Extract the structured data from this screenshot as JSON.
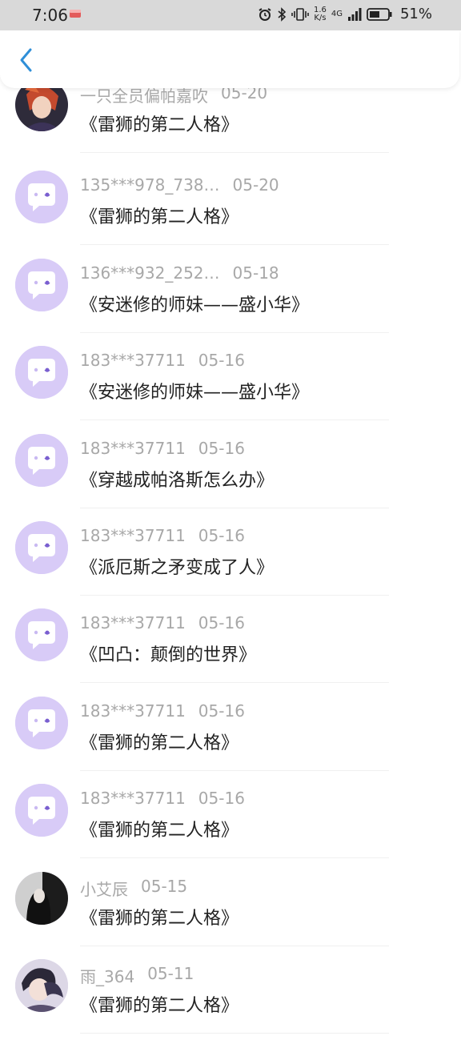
{
  "status": {
    "time": "7:06",
    "speed_value": "1.6",
    "speed_unit": "K/s",
    "network": "4G",
    "battery": "51%"
  },
  "comments": [
    {
      "user": "一只全员偏帕嘉吹",
      "date": "05-20",
      "title": "《雷狮的第二人格》",
      "avatar": "photo-anime-red"
    },
    {
      "user": "135***978_738…",
      "date": "05-20",
      "title": "《雷狮的第二人格》",
      "avatar": "default-purple"
    },
    {
      "user": "136***932_252…",
      "date": "05-18",
      "title": "《安迷修的师妹——盛小华》",
      "avatar": "default-purple"
    },
    {
      "user": "183***37711",
      "date": "05-16",
      "title": "《安迷修的师妹——盛小华》",
      "avatar": "default-purple"
    },
    {
      "user": "183***37711",
      "date": "05-16",
      "title": "《穿越成帕洛斯怎么办》",
      "avatar": "default-purple"
    },
    {
      "user": "183***37711",
      "date": "05-16",
      "title": "《派厄斯之矛变成了人》",
      "avatar": "default-purple"
    },
    {
      "user": "183***37711",
      "date": "05-16",
      "title": "《凹凸：颠倒的世界》",
      "avatar": "default-purple"
    },
    {
      "user": "183***37711",
      "date": "05-16",
      "title": "《雷狮的第二人格》",
      "avatar": "default-purple"
    },
    {
      "user": "183***37711",
      "date": "05-16",
      "title": "《雷狮的第二人格》",
      "avatar": "default-purple"
    },
    {
      "user": "小艾辰",
      "date": "05-15",
      "title": "《雷狮的第二人格》",
      "avatar": "photo-dark"
    },
    {
      "user": "雨_364",
      "date": "05-11",
      "title": "《雷狮的第二人格》",
      "avatar": "photo-anime-couple"
    }
  ]
}
